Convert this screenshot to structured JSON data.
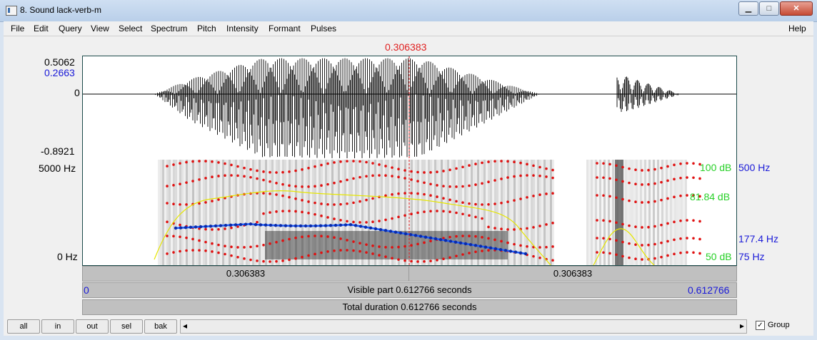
{
  "window": {
    "title": "8. Sound lack-verb-m",
    "minimize": "▁",
    "maximize": "□",
    "close": "✕"
  },
  "menu": [
    "File",
    "Edit",
    "Query",
    "View",
    "Select",
    "Spectrum",
    "Pitch",
    "Intensity",
    "Formant",
    "Pulses"
  ],
  "help": "Help",
  "cursor": {
    "time": "0.306383"
  },
  "waveform": {
    "max": "0.5062",
    "cursor_value": "0.2663",
    "zero": "0",
    "min": "-0.8921"
  },
  "spectrogram": {
    "top_freq": "5000 Hz",
    "bottom_freq": "0 Hz",
    "intensity_max": "100 dB",
    "intensity_value": "81.84 dB",
    "intensity_min": "50 dB",
    "pitch_max": "500 Hz",
    "pitch_value": "177.4 Hz",
    "pitch_min": "75 Hz"
  },
  "time_bars": {
    "left_part": "0.306383",
    "right_part": "0.306383",
    "start": "0",
    "visible_part": "Visible part 0.612766 seconds",
    "end": "0.612766",
    "total": "Total duration 0.612766 seconds"
  },
  "buttons": {
    "all": "all",
    "in": "in",
    "out": "out",
    "sel": "sel",
    "bak": "bak"
  },
  "group": {
    "label": "Group",
    "checked": true,
    "check_mark": "✓"
  },
  "colors": {
    "pitch": "#1a5cff",
    "formant": "#e01010",
    "intensity": "#e6e600",
    "cursor": "#e02020"
  },
  "icons": {
    "scroll_left": "◂",
    "scroll_right": "▸"
  }
}
